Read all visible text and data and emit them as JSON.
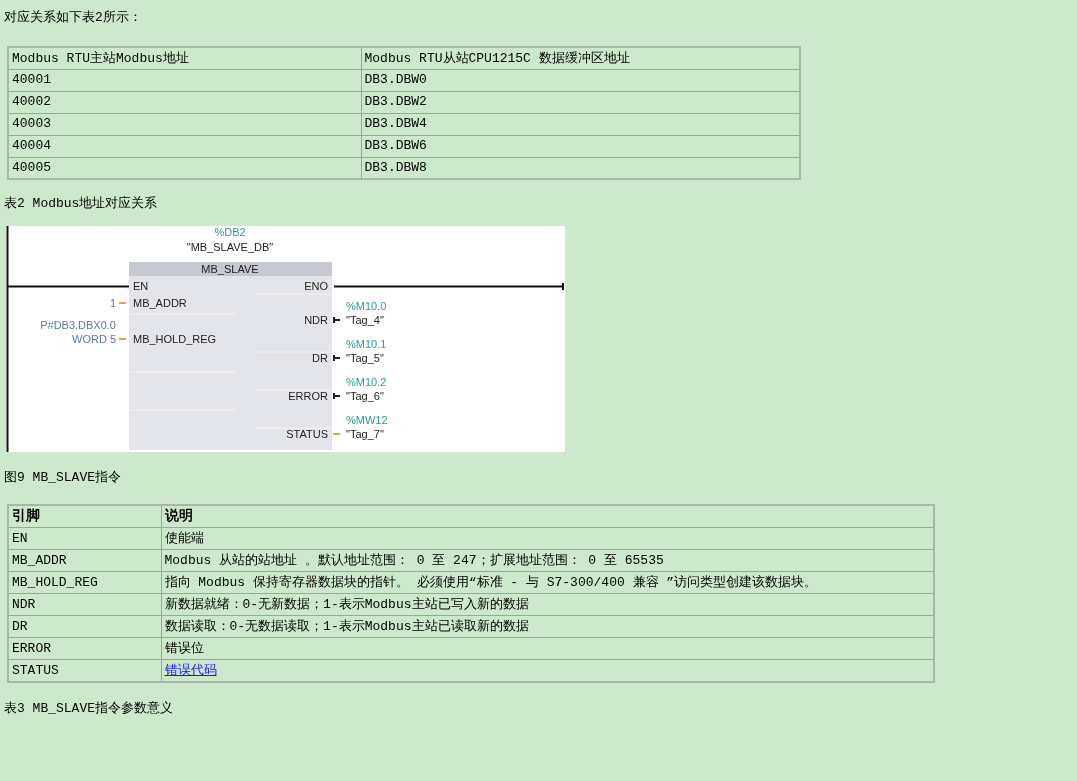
{
  "intro": "对应关系如下表2所示：",
  "table2": {
    "columns": [
      "Modbus RTU主站Modbus地址",
      "Modbus RTU从站CPU1215C 数据缓冲区地址"
    ],
    "rows": [
      [
        "40001",
        "DB3.DBW0"
      ],
      [
        "40002",
        "DB3.DBW2"
      ],
      [
        "40003",
        "DB3.DBW4"
      ],
      [
        "40004",
        "DB3.DBW6"
      ],
      [
        "40005",
        "DB3.DBW8"
      ]
    ]
  },
  "caption2": "表2 Modbus地址对应关系",
  "diagram": {
    "instance_address": "%DB2",
    "instance_name": "\"MB_SLAVE_DB\"",
    "block_name": "MB_SLAVE",
    "en": "EN",
    "eno": "ENO",
    "inputs": [
      {
        "pin": "MB_ADDR",
        "values": [
          "1"
        ]
      },
      {
        "pin": "MB_HOLD_REG",
        "values": [
          "P#DB3.DBX0.0",
          "WORD 5"
        ]
      }
    ],
    "outputs": [
      {
        "pin": "NDR",
        "kind": "bool",
        "address": "%M10.0",
        "tag": "\"Tag_4\""
      },
      {
        "pin": "DR",
        "kind": "bool",
        "address": "%M10.1",
        "tag": "\"Tag_5\""
      },
      {
        "pin": "ERROR",
        "kind": "bool",
        "address": "%M10.2",
        "tag": "\"Tag_6\""
      },
      {
        "pin": "STATUS",
        "kind": "word",
        "address": "%MW12",
        "tag": "\"Tag_7\""
      }
    ]
  },
  "caption9": "图9 MB_SLAVE指令",
  "table3": {
    "columns": [
      "引脚",
      "说明"
    ],
    "rows": [
      {
        "pin": "EN",
        "kind": "text",
        "description": "使能端"
      },
      {
        "pin": "MB_ADDR",
        "kind": "text",
        "description": "Modbus 从站的站地址 。默认地址范围： 0 至 247；扩展地址范围： 0 至 65535"
      },
      {
        "pin": "MB_HOLD_REG",
        "kind": "text",
        "description": "指向 Modbus 保持寄存器数据块的指针。 必须使用“标准 - 与 S7-300/400 兼容 ”访问类型创建该数据块。"
      },
      {
        "pin": "NDR",
        "kind": "text",
        "description": "新数据就绪：0-无新数据；1-表示Modbus主站已写入新的数据"
      },
      {
        "pin": "DR",
        "kind": "text",
        "description": "数据读取：0-无数据读取；1-表示Modbus主站已读取新的数据"
      },
      {
        "pin": "ERROR",
        "kind": "text",
        "description": "错误位"
      },
      {
        "pin": "STATUS",
        "kind": "link",
        "description": "错误代码"
      }
    ]
  },
  "caption3": "表3 MB_SLAVE指令参数意义"
}
